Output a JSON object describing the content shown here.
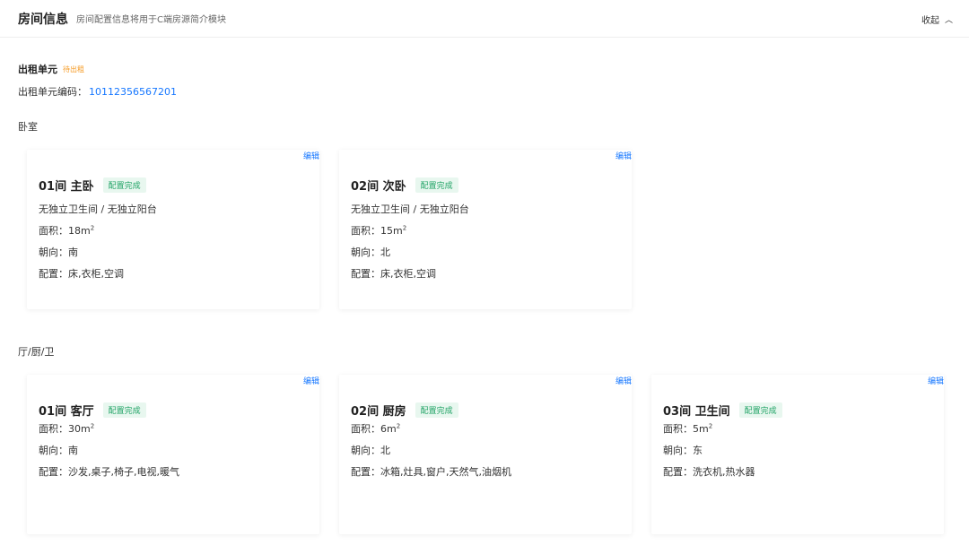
{
  "header": {
    "title": "房间信息",
    "subtitle": "房间配置信息将用于C端房源简介模块",
    "collapse_label": "收起"
  },
  "unit": {
    "title": "出租单元",
    "status": "待出租",
    "code_label": "出租单元编码：",
    "code_value": "10112356567201"
  },
  "sections": {
    "bedroom_label": "卧室",
    "common_label": "厅/厨/卫"
  },
  "common": {
    "edit_label": "编辑",
    "status_label": "配置完成"
  },
  "bedrooms": [
    {
      "name": "01间 主卧",
      "desc": "无独立卫生间 / 无独立阳台",
      "area": "面积：18m",
      "orientation": "朝向：南",
      "config": "配置：床,衣柜,空调"
    },
    {
      "name": "02间 次卧",
      "desc": "无独立卫生间 / 无独立阳台",
      "area": "面积：15m",
      "orientation": "朝向：北",
      "config": "配置：床,衣柜,空调"
    }
  ],
  "commons": [
    {
      "name": "01间 客厅",
      "area": "面积：30m",
      "orientation": "朝向：南",
      "config": "配置：沙发,桌子,椅子,电视,暖气"
    },
    {
      "name": "02间 厨房",
      "area": "面积：6m",
      "orientation": "朝向：北",
      "config": "配置：冰箱,灶具,窗户,天然气,油烟机"
    },
    {
      "name": "03间 卫生间",
      "area": "面积：5m",
      "orientation": "朝向：东",
      "config": "配置：洗衣机,热水器"
    }
  ]
}
